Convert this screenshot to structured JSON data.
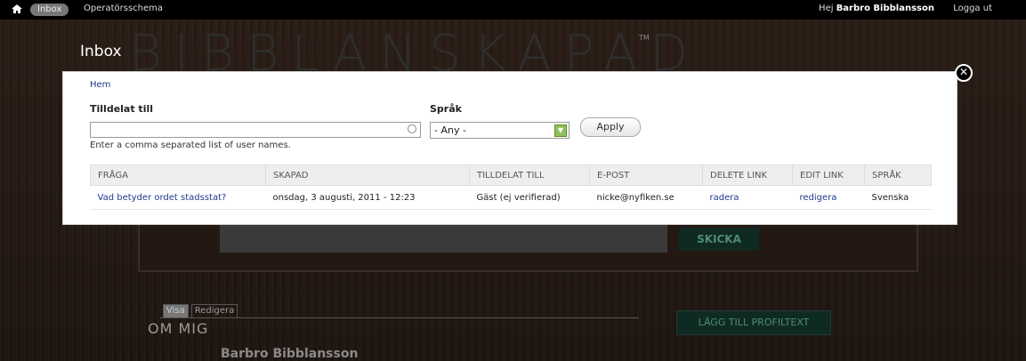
{
  "topbar": {
    "home_icon": "home-icon",
    "inbox_label": "Inbox",
    "schedule_label": "Operatörsschema",
    "greeting_prefix": "Hej",
    "user_name": "Barbro Bibblansson",
    "logout_label": "Logga ut"
  },
  "background_site": {
    "logo_text": "BIBBLANSKAPAD",
    "tm": "TM",
    "send_button": "SKICKA",
    "tabs": [
      "Visa",
      "Redigera"
    ],
    "section_title": "OM MIG",
    "profile_name": "Barbro Bibblansson",
    "add_profile_button": "LÄGG TILL PROFILTEXT"
  },
  "modal": {
    "title": "Inbox",
    "breadcrumb": "Hem",
    "assigned_label": "Tilldelat till",
    "assigned_value": "",
    "assigned_hint": "Enter a comma separated list of user names.",
    "language_label": "Språk",
    "language_selected": "- Any -",
    "apply_label": "Apply",
    "close_icon": "close-icon",
    "table": {
      "headers": [
        "FRÅGA",
        "SKAPAD",
        "TILLDELAT TILL",
        "E-POST",
        "DELETE LINK",
        "EDIT LINK",
        "SPRÅK"
      ],
      "rows": [
        [
          "Vad betyder ordet stadsstat?",
          "onsdag, 3 augusti, 2011 - 12:23",
          "Gäst (ej verifierad)",
          "nicke@nyfiken.se",
          "radera",
          "redigera",
          "Svenska"
        ]
      ]
    }
  },
  "colors": {
    "link": "#1f3a8a",
    "topbar_bg": "#000000",
    "site_button_bg": "#0f2a22",
    "select_arrow": "#8fc05a"
  }
}
